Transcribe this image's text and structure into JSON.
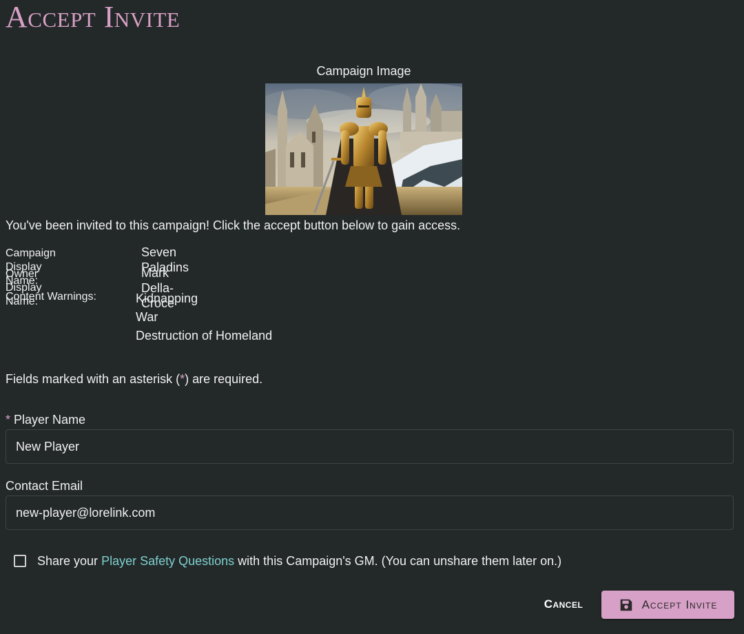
{
  "page": {
    "title": "Accept Invite"
  },
  "campaign_image": {
    "label": "Campaign Image"
  },
  "intro": "You've been invited to this campaign! Click the accept button below to gain access.",
  "details": {
    "campaign_display_name_label": "Campaign Display Name:",
    "campaign_display_name": "Seven Paladins",
    "owner_display_name_label": "Owner Display Name:",
    "owner_display_name": "Mark Della-Croce",
    "content_warnings_label": "Content Warnings:",
    "content_warnings": [
      "Kidnapping",
      "War",
      "Destruction of Homeland"
    ]
  },
  "required_note": {
    "before": "Fields marked with an asterisk (",
    "asterisk": "*",
    "after": ") are required."
  },
  "form": {
    "player_name": {
      "required_marker": "*",
      "label": "Player Name",
      "value": "New Player"
    },
    "contact_email": {
      "label": "Contact Email",
      "value": "new-player@lorelink.com"
    },
    "share": {
      "checked": false,
      "text_before": "Share your ",
      "link_text": "Player Safety Questions",
      "text_after": " with this Campaign's GM. (You can unshare them later on.)"
    }
  },
  "actions": {
    "cancel_label": "Cancel",
    "accept_label": "Accept Invite",
    "accept_icon": "save-icon"
  },
  "colors": {
    "background": "#232828",
    "accent": "#d7a0c6",
    "link": "#7fd0d0",
    "text": "#f1f1f1"
  }
}
